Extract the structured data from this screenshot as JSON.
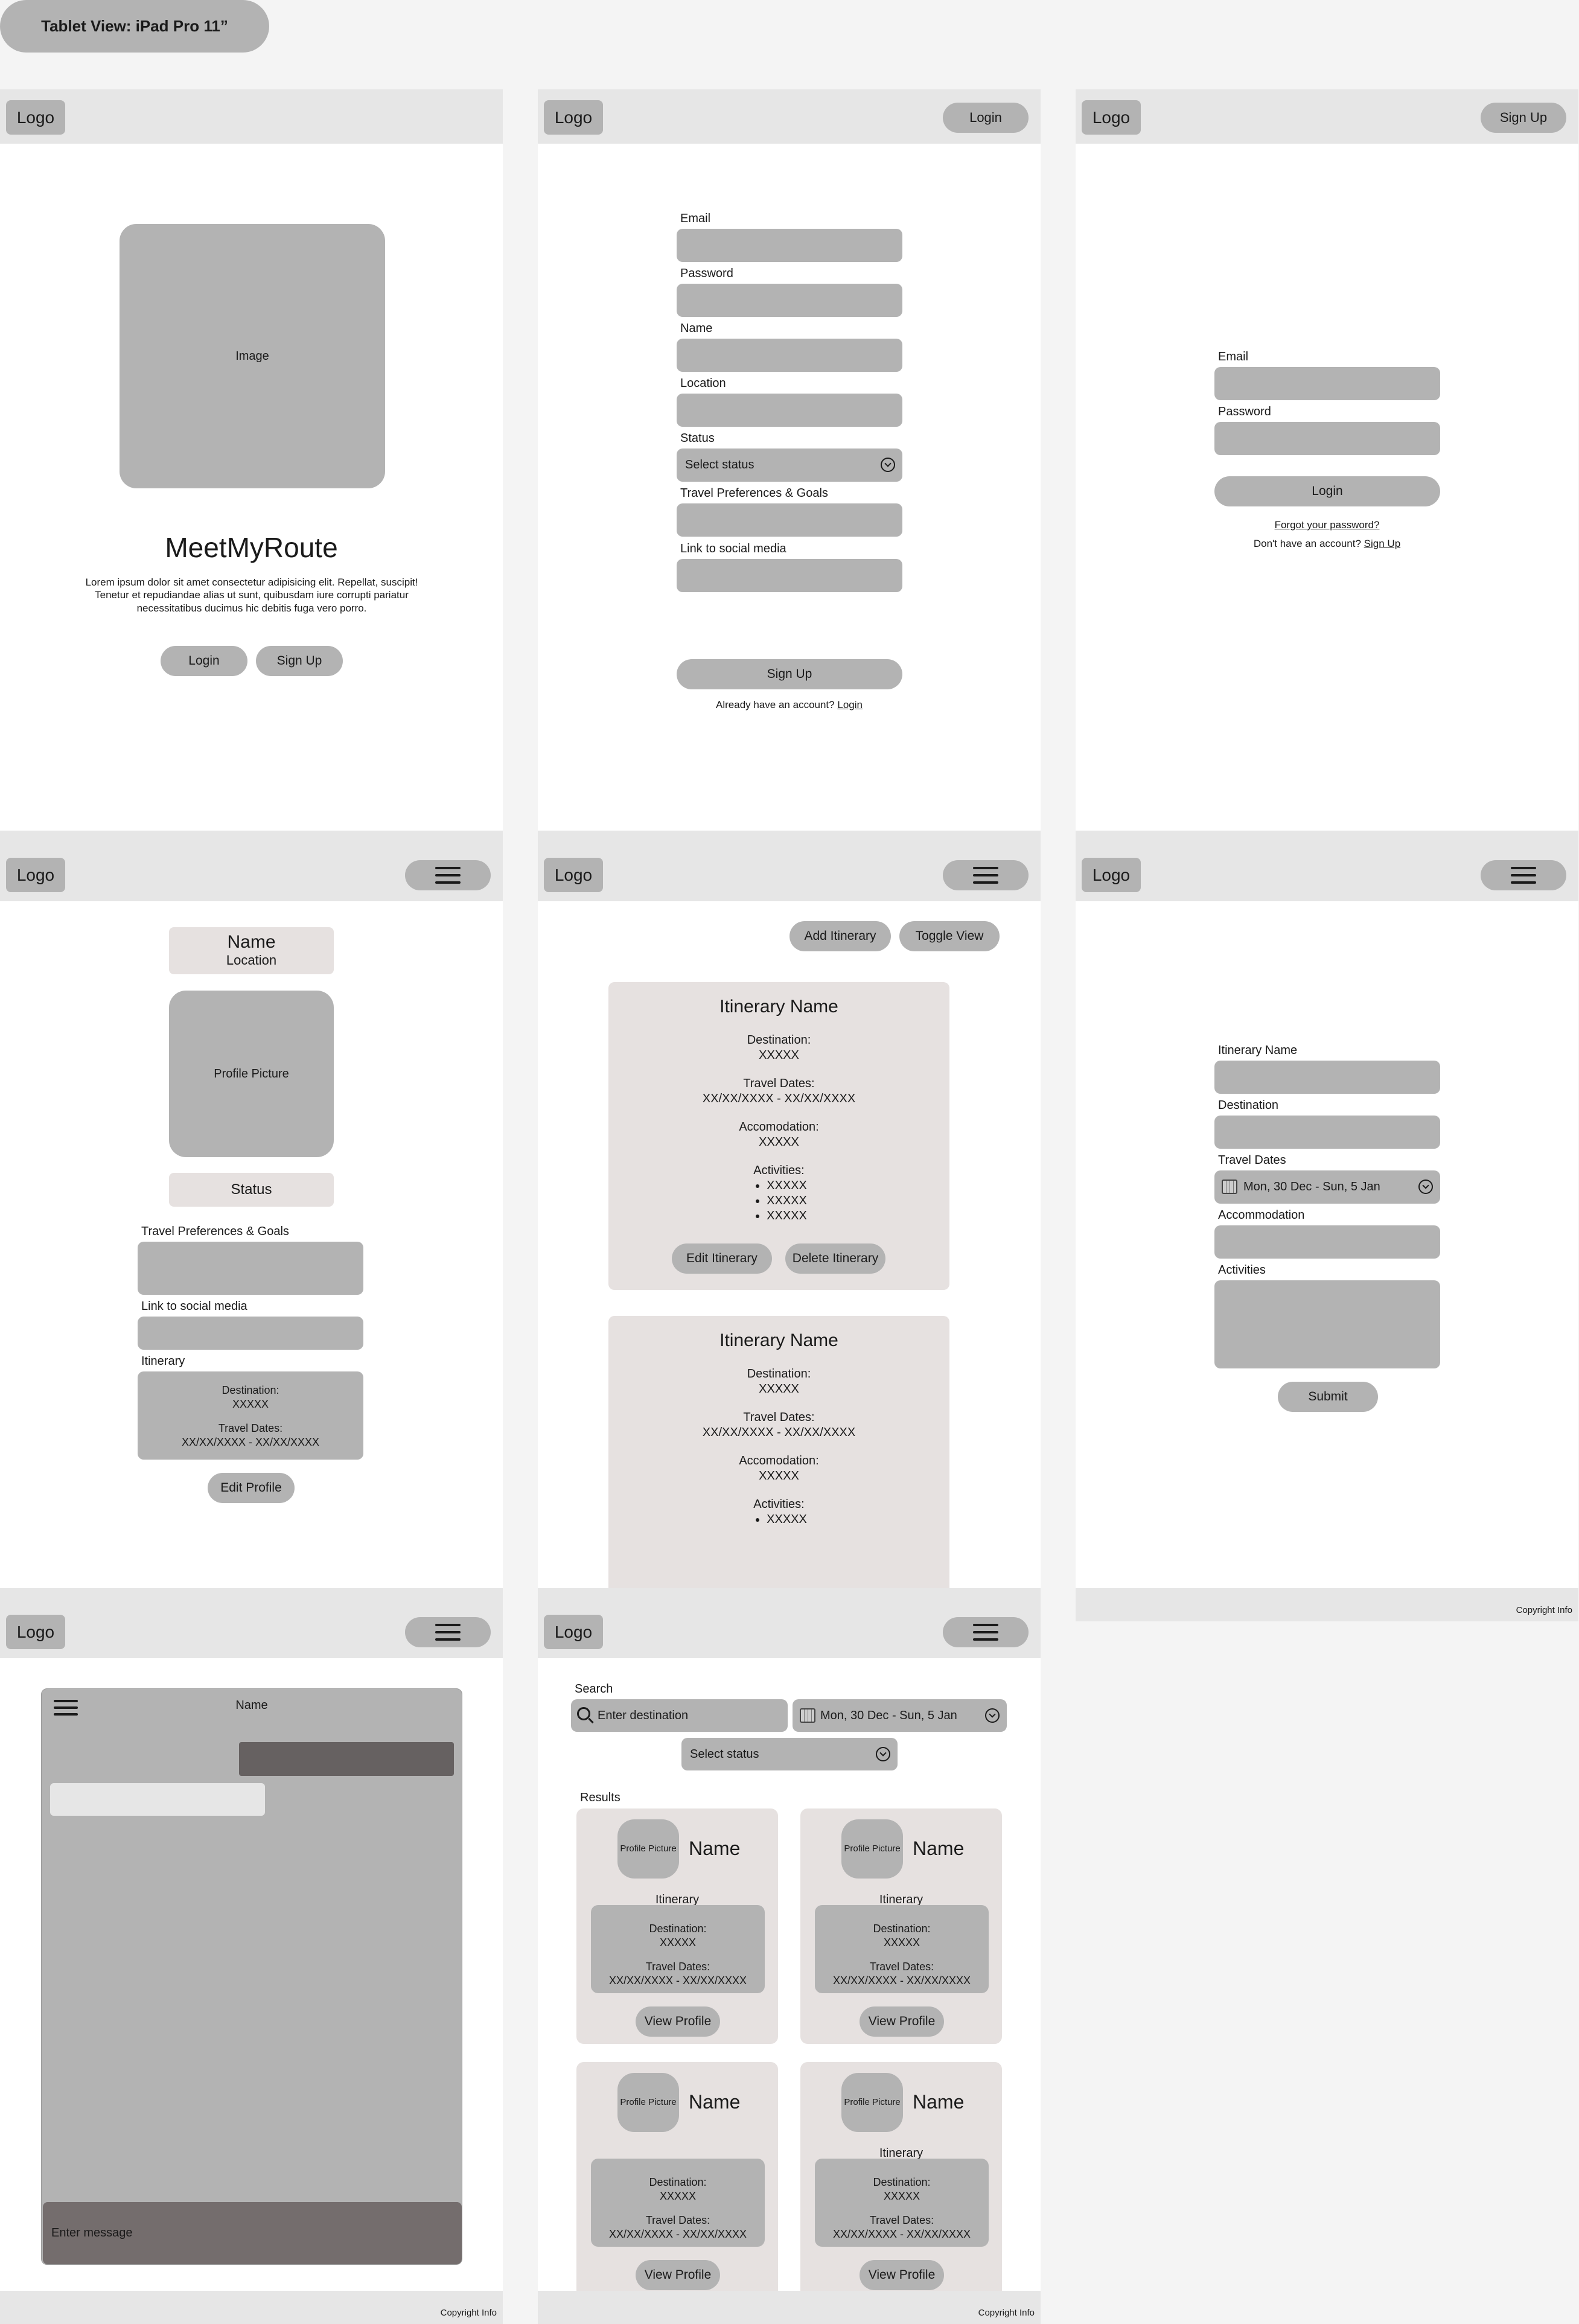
{
  "title": "Tablet View: iPad Pro 11”",
  "common": {
    "logo": "Logo",
    "copyright": "Copyright Info"
  },
  "landing": {
    "image": "Image",
    "app_name": "MeetMyRoute",
    "description": "Lorem ipsum dolor sit amet consectetur adipisicing elit. Repellat, suscipit! Tenetur et repudiandae alias ut sunt, quibusdam iure corrupti pariatur necessitatibus ducimus hic debitis fuga vero porro.",
    "login": "Login",
    "signup": "Sign Up"
  },
  "signup": {
    "header_button": "Login",
    "email": "Email",
    "password": "Password",
    "name": "Name",
    "location": "Location",
    "status": "Status",
    "status_placeholder": "Select status",
    "preferences": "Travel Preferences & Goals",
    "social": "Link to social media",
    "submit": "Sign Up",
    "already": "Already have an account?",
    "login_link": "Login"
  },
  "login": {
    "header_button": "Sign Up",
    "email": "Email",
    "password": "Password",
    "submit": "Login",
    "forgot": "Forgot your password?",
    "no_account": "Don't have an account?",
    "signup_link": "Sign Up"
  },
  "profile": {
    "name": "Name",
    "location": "Location",
    "picture": "Profile Picture",
    "status": "Status",
    "preferences": "Travel Preferences & Goals",
    "social": "Link to social media",
    "itinerary": "Itinerary",
    "destination_label": "Destination:",
    "destination": "XXXXX",
    "dates_label": "Travel Dates:",
    "dates": "XX/XX/XXXX - XX/XX/XXXX",
    "edit": "Edit Profile"
  },
  "itineraries": {
    "add": "Add Itinerary",
    "toggle": "Toggle View",
    "cards": [
      {
        "name": "Itinerary Name",
        "destination_label": "Destination:",
        "destination": "XXXXX",
        "dates_label": "Travel Dates:",
        "dates": "XX/XX/XXXX - XX/XX/XXXX",
        "accom_label": "Accomodation:",
        "accom": "XXXXX",
        "activities_label": "Activities:",
        "activities": [
          "XXXXX",
          "XXXXX",
          "XXXXX"
        ],
        "edit": "Edit Itinerary",
        "delete": "Delete Itinerary"
      },
      {
        "name": "Itinerary Name",
        "destination_label": "Destination:",
        "destination": "XXXXX",
        "dates_label": "Travel Dates:",
        "dates": "XX/XX/XXXX - XX/XX/XXXX",
        "accom_label": "Accomodation:",
        "accom": "XXXXX",
        "activities_label": "Activities:",
        "activities": [
          "XXXXX"
        ]
      }
    ]
  },
  "itinerary_form": {
    "name": "Itinerary Name",
    "destination": "Destination",
    "dates": "Travel Dates",
    "dates_value": "Mon, 30 Dec - Sun, 5 Jan",
    "accommodation": "Accommodation",
    "activities": "Activities",
    "submit": "Submit"
  },
  "chat": {
    "name": "Name",
    "placeholder": "Enter message"
  },
  "search": {
    "label": "Search",
    "placeholder": "Enter destination",
    "dates": "Mon, 30 Dec - Sun, 5 Jan",
    "status": "Select status",
    "results_label": "Results",
    "results": [
      {
        "picture": "Profile Picture",
        "name": "Name",
        "itinerary": "Itinerary",
        "destination_label": "Destination:",
        "destination": "XXXXX",
        "dates_label": "Travel Dates:",
        "dates": "XX/XX/XXXX - XX/XX/XXXX",
        "button": "View Profile"
      },
      {
        "picture": "Profile Picture",
        "name": "Name",
        "itinerary": "Itinerary",
        "destination_label": "Destination:",
        "destination": "XXXXX",
        "dates_label": "Travel Dates:",
        "dates": "XX/XX/XXXX - XX/XX/XXXX",
        "button": "View Profile"
      },
      {
        "picture": "Profile Picture",
        "name": "Name",
        "itinerary": "",
        "destination_label": "Destination:",
        "destination": "XXXXX",
        "dates_label": "Travel Dates:",
        "dates": "XX/XX/XXXX - XX/XX/XXXX",
        "button": "View Profile"
      },
      {
        "picture": "Profile Picture",
        "name": "Name",
        "itinerary": "Itinerary",
        "destination_label": "Destination:",
        "destination": "XXXXX",
        "dates_label": "Travel Dates:",
        "dates": "XX/XX/XXXX - XX/XX/XXXX",
        "button": "View Profile"
      }
    ]
  }
}
